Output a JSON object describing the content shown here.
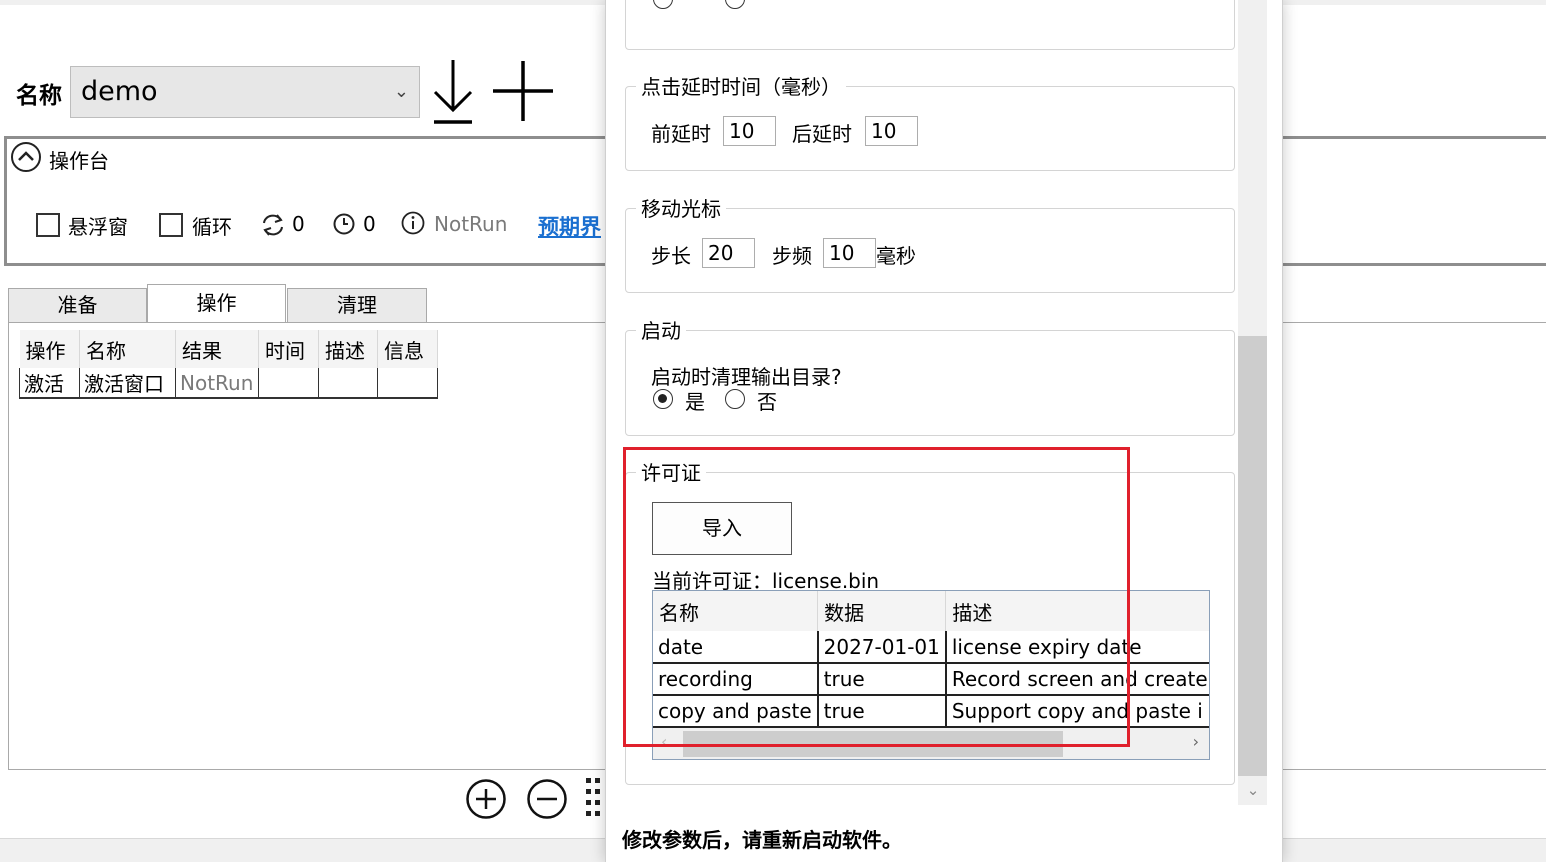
{
  "toolbar": {
    "name_label": "名称",
    "name_value": "demo",
    "dropdown_icon": "chevron-down-icon",
    "download_icon": "download-icon",
    "add_icon": "plus-icon"
  },
  "console": {
    "title": "操作台",
    "float_label": "悬浮窗",
    "loop_label": "循环",
    "repeat_count": "0",
    "timer_count": "0",
    "status": "NotRun",
    "expect_link": "预期界"
  },
  "tabs": [
    "准备",
    "操作",
    "清理"
  ],
  "op_grid": {
    "columns": [
      "操作",
      "名称",
      "结果",
      "时间",
      "描述",
      "信息"
    ],
    "rows": [
      [
        "激活",
        "激活窗口",
        "NotRun",
        "",
        "",
        ""
      ]
    ]
  },
  "settings": {
    "click_delay": {
      "title": "点击延时时间（毫秒）",
      "pre_label": "前延时",
      "pre_value": "10",
      "post_label": "后延时",
      "post_value": "10"
    },
    "move_cursor": {
      "title": "移动光标",
      "step_label": "步长",
      "step_value": "20",
      "freq_label": "步频",
      "freq_value": "10",
      "unit": "毫秒"
    },
    "startup": {
      "title": "启动",
      "question": "启动时清理输出目录?",
      "yes": "是",
      "no": "否",
      "selected": "是"
    },
    "license": {
      "title": "许可证",
      "import_button": "导入",
      "current_label": "当前许可证：license.bin",
      "columns": [
        "名称",
        "数据",
        "描述"
      ],
      "rows": [
        [
          "date",
          "2027-01-01",
          "license expiry date"
        ],
        [
          "recording",
          "true",
          "Record screen and create"
        ],
        [
          "copy and paste",
          "true",
          "Support copy and paste i"
        ]
      ]
    },
    "restart_note": "修改参数后，请重新启动软件。"
  },
  "colors": {
    "highlight": "#e0202c",
    "link": "#1a6fd0",
    "muted": "#7a7a7a"
  }
}
